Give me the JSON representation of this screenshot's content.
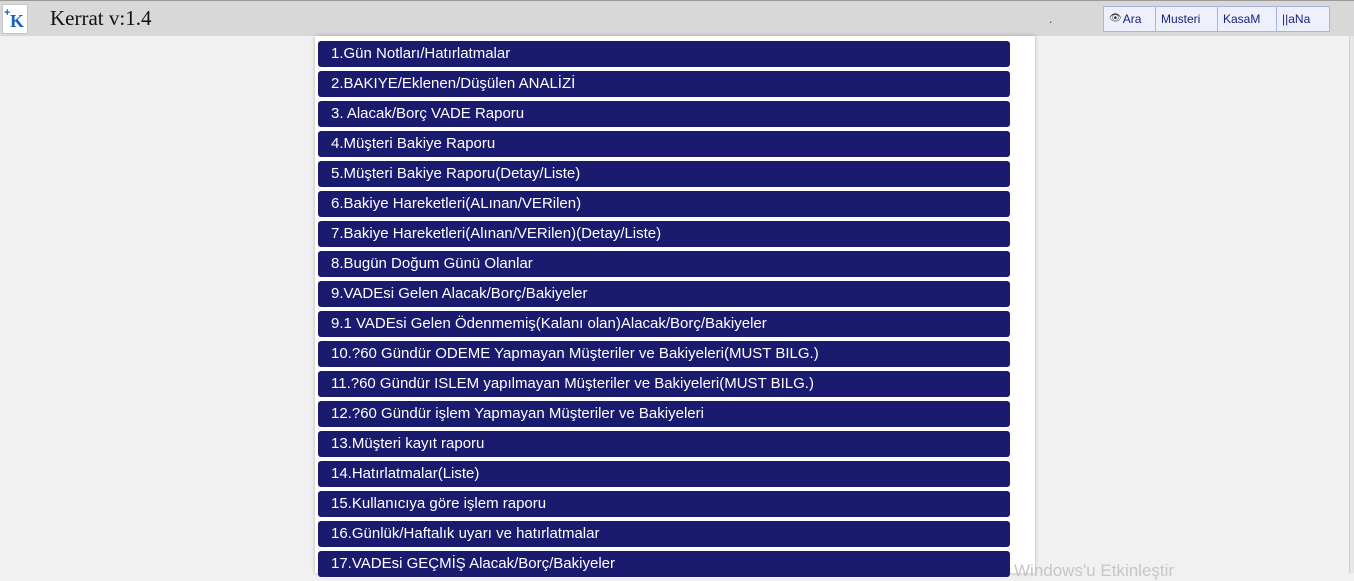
{
  "header": {
    "app_title": "Kerrat v:1.4",
    "dot": ".",
    "logo_icon": "k-logo-icon",
    "nav": [
      {
        "label": "Ara",
        "icon": "eye-icon"
      },
      {
        "label": "Musteri"
      },
      {
        "label": "KasaM"
      },
      {
        "label": "||aNa"
      }
    ]
  },
  "menu": {
    "items": [
      "1.Gün Notları/Hatırlatmalar",
      "2.BAKIYE/Eklenen/Düşülen ANALİZİ",
      "3. Alacak/Borç VADE Raporu",
      "4.Müşteri Bakiye Raporu",
      "5.Müşteri Bakiye Raporu(Detay/Liste)",
      "6.Bakiye Hareketleri(ALınan/VERilen)",
      "7.Bakiye Hareketleri(Alınan/VERilen)(Detay/Liste)",
      "8.Bugün Doğum Günü Olanlar",
      "9.VADEsi Gelen Alacak/Borç/Bakiyeler",
      "9.1 VADEsi Gelen Ödenmemiş(Kalanı olan)Alacak/Borç/Bakiyeler",
      "10.?60 Gündür ODEME Yapmayan Müşteriler ve Bakiyeleri(MUST BILG.)",
      "11.?60 Gündür ISLEM yapılmayan Müşteriler ve Bakiyeleri(MUST BILG.)",
      "12.?60 Gündür işlem Yapmayan Müşteriler ve Bakiyeleri",
      "13.Müşteri kayıt raporu",
      "14.Hatırlatmalar(Liste)",
      "15.Kullanıcıya göre işlem raporu",
      "16.Günlük/Haftalık uyarı ve hatırlatmalar",
      "17.VADEsi GEÇMİŞ Alacak/Borç/Bakiyeler"
    ]
  },
  "watermark": "Windows'u Etkinleştir",
  "colors": {
    "menu_bg": "#1a1a6e",
    "topbar_bg": "#d8d8d8",
    "nav_text": "#1a237e"
  }
}
